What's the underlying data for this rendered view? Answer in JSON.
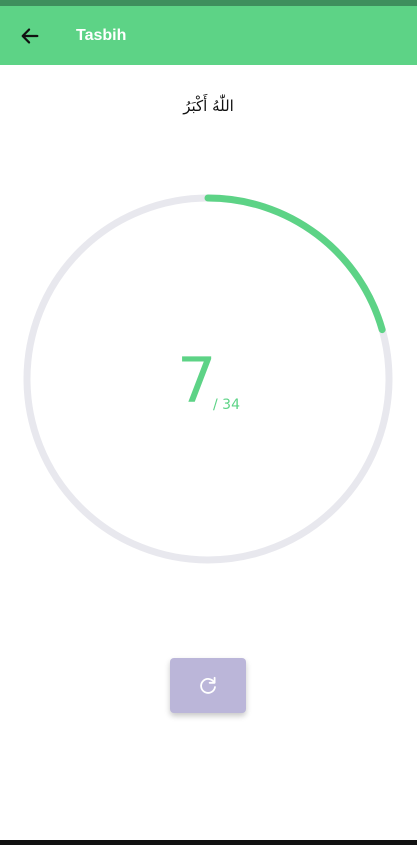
{
  "app_bar": {
    "title": "Tasbih",
    "color": "#5dd386",
    "back_icon": "arrow-left-icon"
  },
  "dhikr": {
    "text": "اللّٰهُ أَكْبَرُ"
  },
  "counter": {
    "count": "7",
    "target_label": "/ 34",
    "progress": 0.206,
    "accent_color": "#5dd386",
    "track_color": "#e8e8ee"
  },
  "reset": {
    "icon": "refresh-icon",
    "color": "#bbb6d9"
  }
}
